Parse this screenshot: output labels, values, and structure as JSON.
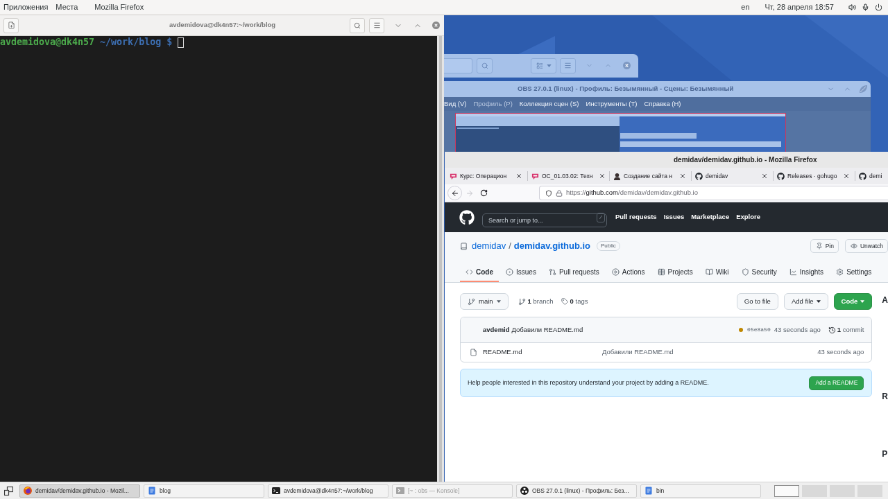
{
  "top_panel": {
    "menus": [
      "Приложения",
      "Места"
    ],
    "active_app": "Mozilla Firefox",
    "keyboard_layout": "en",
    "clock": "Чт, 28 апреля 18:57"
  },
  "terminal": {
    "title": "avdemidova@dk4n57:~/work/blog",
    "prompt_user": "avdemidova@dk4n57",
    "prompt_path": "~/work/blog $"
  },
  "obs": {
    "title": "OBS 27.0.1 (linux) - Профиль: Безымянный - Сцены: Безымянный",
    "menu": [
      {
        "label": "Вид (V)",
        "disabled": false
      },
      {
        "label": "Профиль (P)",
        "disabled": true
      },
      {
        "label": "Коллекция сцен (S)",
        "disabled": false
      },
      {
        "label": "Инструменты (T)",
        "disabled": false
      },
      {
        "label": "Справка (H)",
        "disabled": false
      }
    ]
  },
  "firefox": {
    "title": "demidav/demidav.github.io - Mozilla Firefox",
    "tabs": [
      {
        "label": "Курс: Операцион",
        "kind": "course",
        "selected": false
      },
      {
        "label": "ОС_01.03.02: Техн",
        "kind": "course",
        "selected": false
      },
      {
        "label": "Создание сайта н",
        "kind": "person",
        "selected": false
      },
      {
        "label": "demidav",
        "kind": "github",
        "selected": false
      },
      {
        "label": "Releases · gohugo",
        "kind": "github",
        "selected": false
      },
      {
        "label": "demi",
        "kind": "github",
        "selected": false
      }
    ],
    "forward_button": {
      "disabled": true
    },
    "url": {
      "scheme": "https://",
      "host": "github.com",
      "path": "/demidav/demidav.github.io"
    }
  },
  "github": {
    "search_placeholder": "Search or jump to...",
    "search_key": "/",
    "nav": [
      "Pull requests",
      "Issues",
      "Marketplace",
      "Explore"
    ],
    "owner": "demidav",
    "separator": "/",
    "repo": "demidav.github.io",
    "visibility": "Public",
    "repo_actions": [
      {
        "label": "Pin",
        "kind": "pin"
      },
      {
        "label": "Unwatch",
        "kind": "watch"
      }
    ],
    "tabs": [
      {
        "label": "Code",
        "kind": "code",
        "selected": true
      },
      {
        "label": "Issues",
        "kind": "issues",
        "selected": false
      },
      {
        "label": "Pull requests",
        "kind": "pulls",
        "selected": false
      },
      {
        "label": "Actions",
        "kind": "actions",
        "selected": false
      },
      {
        "label": "Projects",
        "kind": "projects",
        "selected": false
      },
      {
        "label": "Wiki",
        "kind": "wiki",
        "selected": false
      },
      {
        "label": "Security",
        "kind": "security",
        "selected": false
      },
      {
        "label": "Insights",
        "kind": "insights",
        "selected": false
      },
      {
        "label": "Settings",
        "kind": "settings",
        "selected": false
      }
    ],
    "branch": "main",
    "branches": "**1** branch",
    "tags": "**0** tags",
    "buttons": [
      {
        "label": "Go to file",
        "kind": "plain"
      },
      {
        "label": "Add file",
        "kind": "menu"
      },
      {
        "label": "Code",
        "kind": "primary"
      }
    ],
    "latest_commit": {
      "author": "avdemid",
      "message": "Добавили README.md",
      "color": "#bf8700",
      "sha": "05e8a50",
      "time": "43 seconds ago",
      "commits": "**1** commit"
    },
    "files": [
      {
        "name": "README.md",
        "message": "Добавили README.md",
        "time": "43 seconds ago"
      }
    ],
    "readme_prompt": {
      "text": "Help people interested in this repository understand your project by adding a README.",
      "button": "Add a README"
    },
    "sidebar_cut_headings": [
      "A",
      "R",
      "P"
    ]
  },
  "taskbar": {
    "items": [
      {
        "label": "demidav/demidav.github.io - Mozil...",
        "kind": "browser",
        "selected": true,
        "minimized": false
      },
      {
        "label": "blog",
        "kind": "editor",
        "selected": false,
        "minimized": false
      },
      {
        "label": "avdemidova@dk4n57:~/work/blog",
        "kind": "terminal",
        "selected": false,
        "minimized": false
      },
      {
        "label": "[~ : obs — Konsole]",
        "kind": "konsole",
        "selected": false,
        "minimized": true
      },
      {
        "label": "OBS 27.0.1 (linux) - Профиль: Без...",
        "kind": "obs",
        "selected": false,
        "minimized": false
      },
      {
        "label": "bin",
        "kind": "editor",
        "selected": false,
        "minimized": false
      }
    ],
    "workspaces": [
      {
        "selected": true
      },
      {
        "selected": false
      },
      {
        "selected": false
      },
      {
        "selected": false
      }
    ]
  }
}
